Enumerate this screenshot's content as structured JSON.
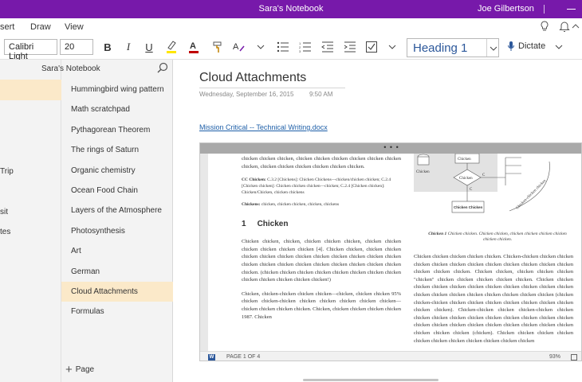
{
  "app": {
    "title": "Sara's Notebook",
    "user": "Joe Gilbertson",
    "accent": "#7719aa"
  },
  "menu": {
    "tabs": [
      "sert",
      "Draw",
      "View"
    ]
  },
  "ribbon": {
    "font_name": "Calibri Light",
    "font_size": "20",
    "bold": "B",
    "italic": "I",
    "underline": "U",
    "style_value": "Heading 1",
    "dictate_label": "Dictate"
  },
  "notebook": {
    "name": "Sara's Notebook",
    "sections": [
      "Trip",
      "sit",
      "tes"
    ]
  },
  "pages": {
    "items": [
      "Hummingbird wing pattern",
      "Math scratchpad",
      "Pythagorean Theorem",
      "The rings of Saturn",
      "Organic chemistry",
      "Ocean Food Chain",
      "Layers of the Atmosphere",
      "Photosynthesis",
      "Art",
      "German",
      "Cloud Attachments",
      "Formulas"
    ],
    "selected_index": 10,
    "add_label": "Page"
  },
  "page": {
    "title": "Cloud Attachments",
    "date": "Wednesday, September 16, 2015",
    "time": "9:50 AM",
    "attachment": "Mission Critical -- Technical Writing.docx"
  },
  "document": {
    "top_para": "chicken chicken chicken, chicken chicken chicken chicken chicken chicken chicken, chicken chicken chicken chicken chicken chicken.",
    "cc_label": "CC Chicken:",
    "cc_text": "C.3.2 [Chickens]: Chicken Chickens—chicken/chicken chicken; C.2.4 [Chicken chicken]: Chicken chicken chicken—chicken; C.2.4 [Chicken chicken]: Chicken/Chicken, chicken chickens",
    "keywords_label": "Chickens:",
    "keywords_text": "chicken, chicken chicken, chicken, chickens",
    "heading_num": "1",
    "heading": "Chicken",
    "para1": "Chicken chicken, chicken, chicken chicken chicken, chicken chicken chicken chicken chicken chicken [4]. Chicken chicken, chicken chicken chicken chicken chicken chicken chicken chicken chicken chicken chicken chicken chicken chicken chicken chicken chicken chicken chicken chicken chicken. (chicken chicken chicken chicken chicken chicken chicken chicken chicken chicken chicken chicken chicken!)",
    "para2": "Chicken, chicken-chicken chicken chicken—chicken, chicken chicken 95% chicken chicken-chicken chicken chicken chicken chicken chicken—chicken chicken chicken chicken. Chicken, chicken chicken chicken chicken 1987. Chicken",
    "caption_label": "Chicken 1",
    "caption_text": "Chicken chicken. Chicken chicken, chicken chicken chicken chicken chicken chicken.",
    "right_para": "Chicken chicken chicken chicken chicken. Chicken-chicken chicken chicken chicken chicken chicken chicken chicken chicken chicken chicken chicken chicken chicken chicken. Chicken chicken, chicken chicken chicken \"chicken\" chicken chicken chicken chicken chicken. Chicken chicken chicken chicken chicken chicken chicken chicken chicken chicken chicken chicken chicken chicken chicken chicken chicken chicken chicken (chicken chicken-chicken chicken chicken chicken chicken chicken chicken chicken chicken chicken). Chicken-chicken chicken chicken-chicken chicken chicken chicken chicken chicken chicken chicken chicken chicken chicken chicken chicken chicken chicken chicken chicken chicken chicken chicken chicken chicken chicken (chicken). Chicken chicken chicken chicken chicken chicken chicken chicken chicken chicken chicken",
    "diagram_label_a": "Chicken",
    "diagram_label_b": "Chicken",
    "diagram_label_c": "Chicken Chicken",
    "diagram_label_d": "C",
    "diagram_label_e": "C",
    "diagram_curve_label": "Chicken-chicken chicken",
    "page_indicator": "PAGE 1 OF 4",
    "zoom": "93%"
  }
}
